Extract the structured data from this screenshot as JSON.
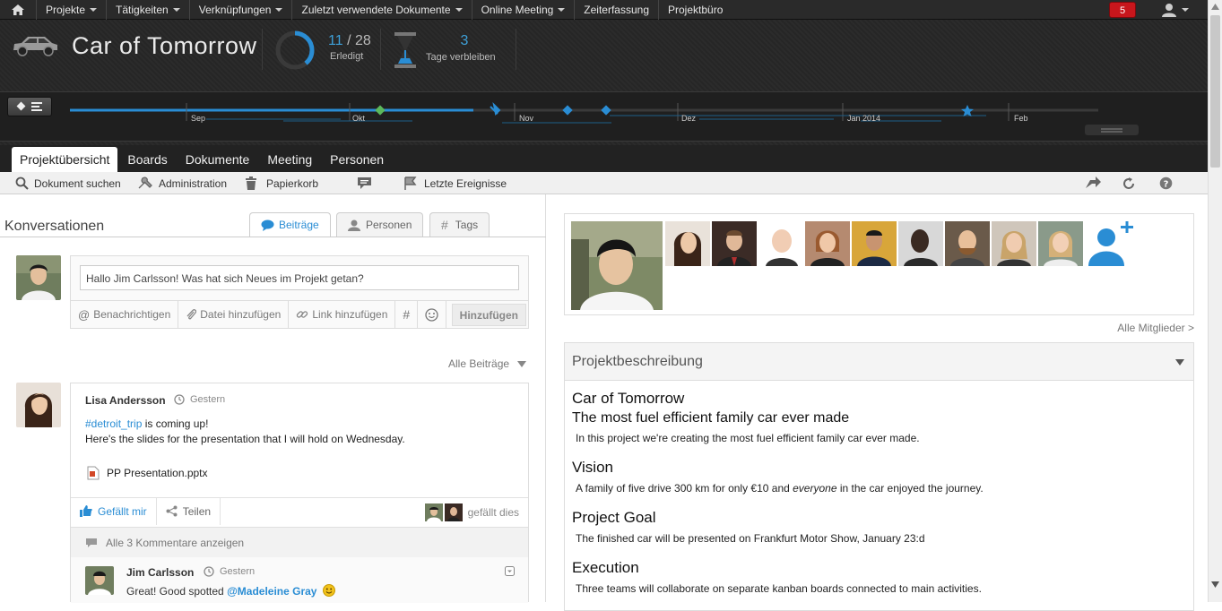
{
  "topnav": {
    "items": [
      "Projekte",
      "Tätigkeiten",
      "Verknüpfungen",
      "Zuletzt verwendete Dokumente",
      "Online Meeting",
      "Zeiterfassung",
      "Projektbüro"
    ],
    "notifications": "5"
  },
  "header": {
    "project_title": "Car of Tomorrow",
    "done_count": "11",
    "done_total": "/ 28",
    "done_label": "Erledigt",
    "done_fraction": 0.39,
    "days_remaining": "3",
    "days_label": "Tage verbleiben"
  },
  "timeline": {
    "months": [
      "Sep",
      "Okt",
      "Nov",
      "Dez",
      "Jan 2014",
      "Feb"
    ]
  },
  "tabs": [
    "Projektübersicht",
    "Boards",
    "Dokumente",
    "Meeting",
    "Personen"
  ],
  "toolbar": {
    "search": "Dokument suchen",
    "admin": "Administration",
    "trash": "Papierkorb",
    "events": "Letzte Ereignisse"
  },
  "conversations": {
    "title": "Konversationen",
    "tabs": [
      "Beiträge",
      "Personen",
      "Tags"
    ],
    "input_value": "Hallo Jim Carlsson! Was hat sich Neues im Projekt getan?",
    "notify": "Benachrichtigen",
    "add_file": "Datei hinzufügen",
    "add_link": "Link hinzufügen",
    "hash": "#",
    "submit": "Hinzufügen",
    "all_posts": "Alle Beiträge"
  },
  "post": {
    "author": "Lisa Andersson",
    "time": "Gestern",
    "hashtag": "#detroit_trip",
    "line1_rest": " is coming up!",
    "line2": "Here's the slides for the presentation that I will hold on Wednesday.",
    "attachment": "PP Presentation.pptx",
    "like": "Gefällt mir",
    "share": "Teilen",
    "liked_text": "gefällt dies",
    "show_comments": "Alle 3 Kommentare anzeigen"
  },
  "comment": {
    "author": "Jim Carlsson",
    "time": "Gestern",
    "text": "Great! Good spotted ",
    "mention": "@Madeleine Gray"
  },
  "members": {
    "all_members": "Alle Mitglieder >"
  },
  "description": {
    "heading": "Projektbeschreibung",
    "title": "Car of Tomorrow",
    "subtitle": "The most fuel efficient family car ever made",
    "intro": "In this project we're creating the most fuel efficient family car ever made.",
    "vision_h": "Vision",
    "vision_a": "A family of five drive 300 km for only €10 and ",
    "vision_em": "everyone",
    "vision_b": " in the car enjoyed the journey.",
    "goal_h": "Project Goal",
    "goal": "The finished car will be presented on Frankfurt Motor Show, January 23:d",
    "exec_h": "Execution",
    "exec": "Three teams will collaborate on separate kanban boards connected to main activities."
  },
  "colors": {
    "accent": "#2a8dd4",
    "badge": "#c8161c",
    "topbar": "#2a2a2a"
  }
}
